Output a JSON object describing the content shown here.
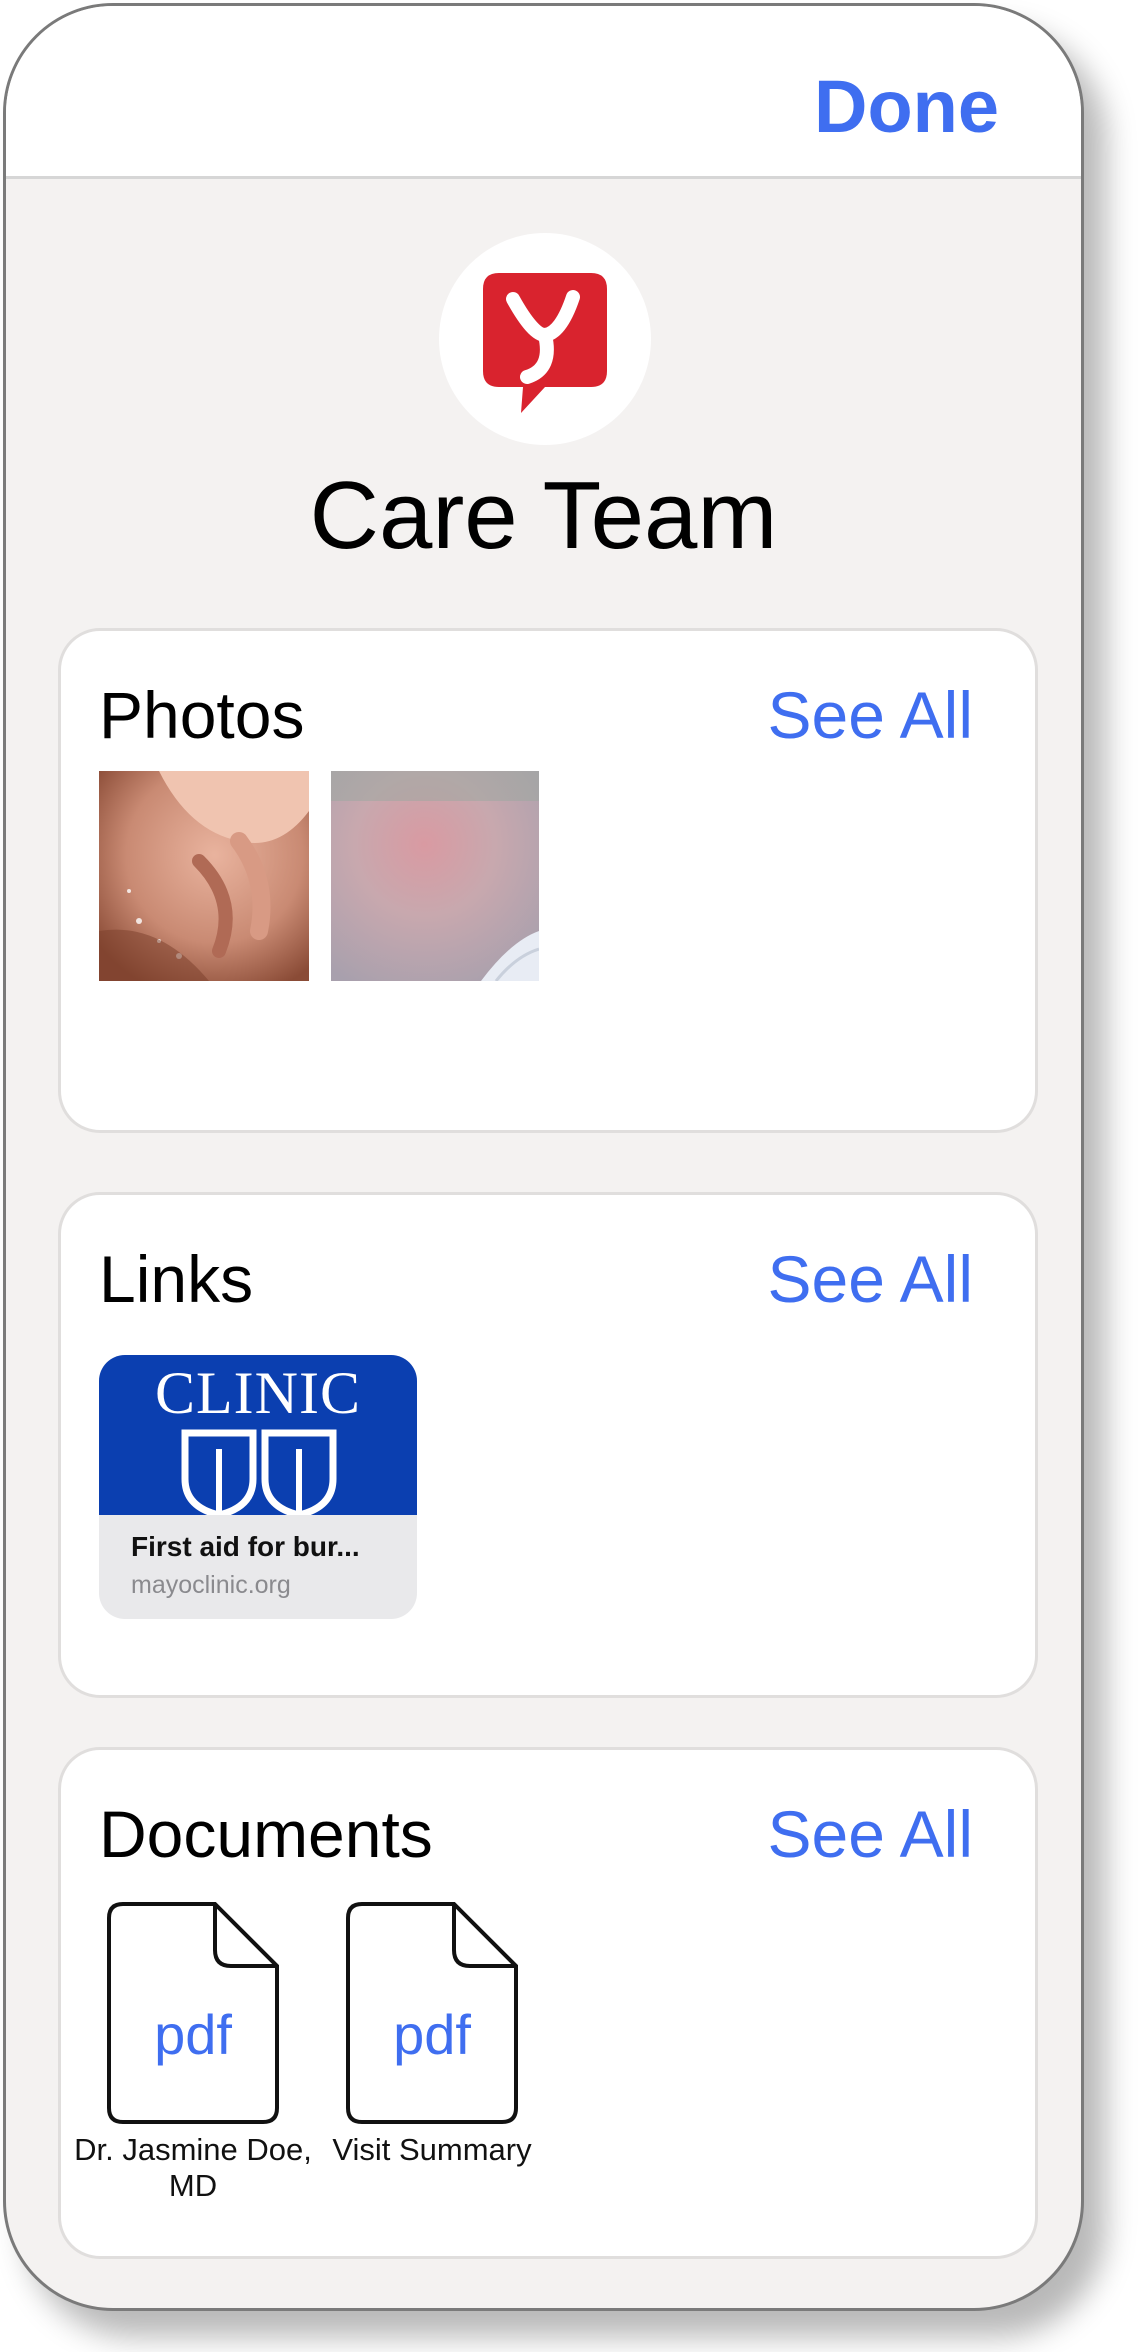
{
  "header": {
    "done_label": "Done"
  },
  "profile": {
    "name": "Care Team",
    "icon": "care-team-logo-icon",
    "brand_color": "#d9232e"
  },
  "photos": {
    "title": "Photos",
    "see_all": "See All",
    "count": 2
  },
  "links": {
    "title": "Links",
    "see_all": "See All",
    "items": [
      {
        "title": "First aid for bur...",
        "domain": "mayoclinic.org",
        "thumb_text": "CLINIC"
      }
    ]
  },
  "documents": {
    "title": "Documents",
    "see_all": "See All",
    "items": [
      {
        "type": "pdf",
        "label": "Dr. Jasmine Doe, MD"
      },
      {
        "type": "pdf",
        "label": "Visit Summary"
      }
    ]
  },
  "colors": {
    "accent": "#3f6ef0",
    "background": "#f4f2f1"
  }
}
